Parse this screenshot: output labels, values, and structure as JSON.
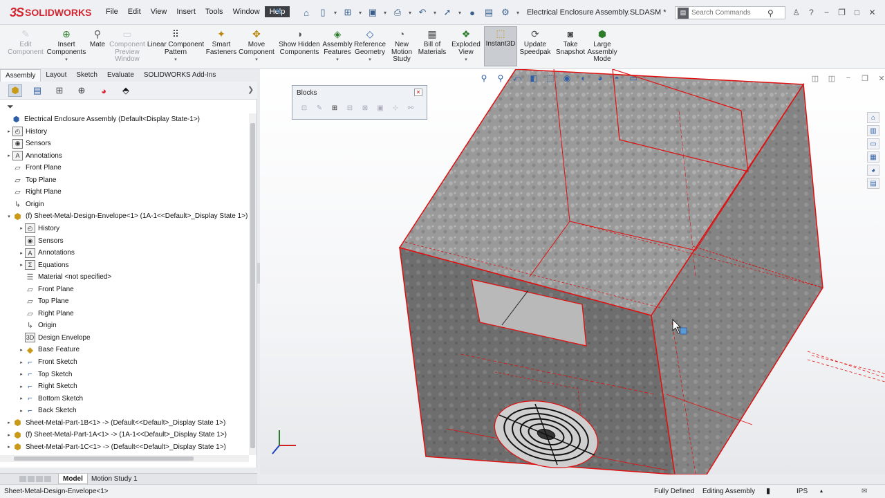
{
  "app": {
    "logo_mark": "3S",
    "logo_text": "SOLIDWORKS",
    "doc_title": "Electrical Enclosure Assembly.SLDASM *"
  },
  "menu": [
    "File",
    "Edit",
    "View",
    "Insert",
    "Tools",
    "Window",
    "Help"
  ],
  "search": {
    "placeholder": "Search Commands"
  },
  "ribbon": [
    {
      "label": "Edit Component",
      "icon": "edit-component-icon",
      "state": "disabled"
    },
    {
      "label": "Insert Components",
      "icon": "insert-components-icon",
      "state": "normal"
    },
    {
      "label": "Mate",
      "icon": "mate-icon",
      "state": "normal"
    },
    {
      "label": "Component Preview Window",
      "icon": "preview-window-icon",
      "state": "disabled"
    },
    {
      "label": "Linear Component Pattern",
      "icon": "pattern-icon",
      "state": "normal"
    },
    {
      "label": "Smart Fasteners",
      "icon": "fastener-icon",
      "state": "normal"
    },
    {
      "label": "Move Component",
      "icon": "move-icon",
      "state": "normal"
    },
    {
      "label": "Show Hidden Components",
      "icon": "show-hidden-icon",
      "state": "normal"
    },
    {
      "label": "Assembly Features",
      "icon": "assembly-features-icon",
      "state": "normal"
    },
    {
      "label": "Reference Geometry",
      "icon": "reference-geometry-icon",
      "state": "normal"
    },
    {
      "label": "New Motion Study",
      "icon": "motion-study-icon",
      "state": "normal"
    },
    {
      "label": "Bill of Materials",
      "icon": "bom-icon",
      "state": "normal"
    },
    {
      "label": "Exploded View",
      "icon": "exploded-view-icon",
      "state": "normal"
    },
    {
      "label": "Instant3D",
      "icon": "instant3d-icon",
      "state": "selected"
    },
    {
      "label": "Update Speedpak",
      "icon": "speedpak-icon",
      "state": "normal"
    },
    {
      "label": "Take Snapshot",
      "icon": "snapshot-icon",
      "state": "normal"
    },
    {
      "label": "Large Assembly Mode",
      "icon": "large-assembly-icon",
      "state": "normal"
    }
  ],
  "cm_tabs": [
    "Assembly",
    "Layout",
    "Sketch",
    "Evaluate",
    "SOLIDWORKS Add-Ins"
  ],
  "cm_active": "Assembly",
  "tree": [
    {
      "label": "Electrical Enclosure Assembly  (Default<Display State-1>)",
      "icon": "assembly-icon",
      "indent": 0,
      "exp": ""
    },
    {
      "label": "History",
      "icon": "history-icon",
      "indent": 1,
      "exp": "▸"
    },
    {
      "label": "Sensors",
      "icon": "sensors-icon",
      "indent": 1,
      "exp": ""
    },
    {
      "label": "Annotations",
      "icon": "annotations-icon",
      "indent": 1,
      "exp": "▸"
    },
    {
      "label": "Front Plane",
      "icon": "plane-icon",
      "indent": 1,
      "exp": ""
    },
    {
      "label": "Top Plane",
      "icon": "plane-icon",
      "indent": 1,
      "exp": ""
    },
    {
      "label": "Right Plane",
      "icon": "plane-icon",
      "indent": 1,
      "exp": ""
    },
    {
      "label": "Origin",
      "icon": "origin-icon",
      "indent": 1,
      "exp": ""
    },
    {
      "label": "(f) Sheet-Metal-Design-Envelope<1> (1A-1<<Default>_Display State 1>)",
      "icon": "part-icon",
      "indent": 1,
      "exp": "▾"
    },
    {
      "label": "History",
      "icon": "history-icon",
      "indent": 2,
      "exp": "▸"
    },
    {
      "label": "Sensors",
      "icon": "sensors-icon",
      "indent": 2,
      "exp": ""
    },
    {
      "label": "Annotations",
      "icon": "annotations-icon",
      "indent": 2,
      "exp": "▸"
    },
    {
      "label": "Equations",
      "icon": "equations-icon",
      "indent": 2,
      "exp": "▸"
    },
    {
      "label": "Material <not specified>",
      "icon": "material-icon",
      "indent": 2,
      "exp": ""
    },
    {
      "label": "Front Plane",
      "icon": "plane-icon",
      "indent": 2,
      "exp": ""
    },
    {
      "label": "Top Plane",
      "icon": "plane-icon",
      "indent": 2,
      "exp": ""
    },
    {
      "label": "Right Plane",
      "icon": "plane-icon",
      "indent": 2,
      "exp": ""
    },
    {
      "label": "Origin",
      "icon": "origin-icon",
      "indent": 2,
      "exp": ""
    },
    {
      "label": "Design Envelope",
      "icon": "design-envelope-icon",
      "indent": 2,
      "exp": ""
    },
    {
      "label": "Base Feature",
      "icon": "base-feature-icon",
      "indent": 2,
      "exp": "▸"
    },
    {
      "label": "Front Sketch",
      "icon": "sketch-icon",
      "indent": 2,
      "exp": "▸"
    },
    {
      "label": "Top Sketch",
      "icon": "sketch-icon",
      "indent": 2,
      "exp": "▸"
    },
    {
      "label": "Right Sketch",
      "icon": "sketch-icon",
      "indent": 2,
      "exp": "▸"
    },
    {
      "label": "Bottom Sketch",
      "icon": "sketch-icon",
      "indent": 2,
      "exp": "▸"
    },
    {
      "label": "Back Sketch",
      "icon": "sketch-icon",
      "indent": 2,
      "exp": "▸"
    },
    {
      "label": "Sheet-Metal-Part-1B<1> -> (Default<<Default>_Display State 1>)",
      "icon": "part-icon",
      "indent": 1,
      "exp": "▸"
    },
    {
      "label": "(f) Sheet-Metal-Part-1A<1> -> (1A-1<<Default>_Display State 1>)",
      "icon": "part-icon",
      "indent": 1,
      "exp": "▸"
    },
    {
      "label": "Sheet-Metal-Part-1C<1> -> (Default<<Default>_Display State 1>)",
      "icon": "part-icon",
      "indent": 1,
      "exp": "▸"
    }
  ],
  "blocks": {
    "title": "Blocks"
  },
  "bottom_tabs": [
    "Model",
    "Motion Study 1"
  ],
  "status": {
    "left": "Sheet-Metal-Design-Envelope<1>",
    "defined": "Fully Defined",
    "mode": "Editing Assembly",
    "units": "IPS"
  }
}
